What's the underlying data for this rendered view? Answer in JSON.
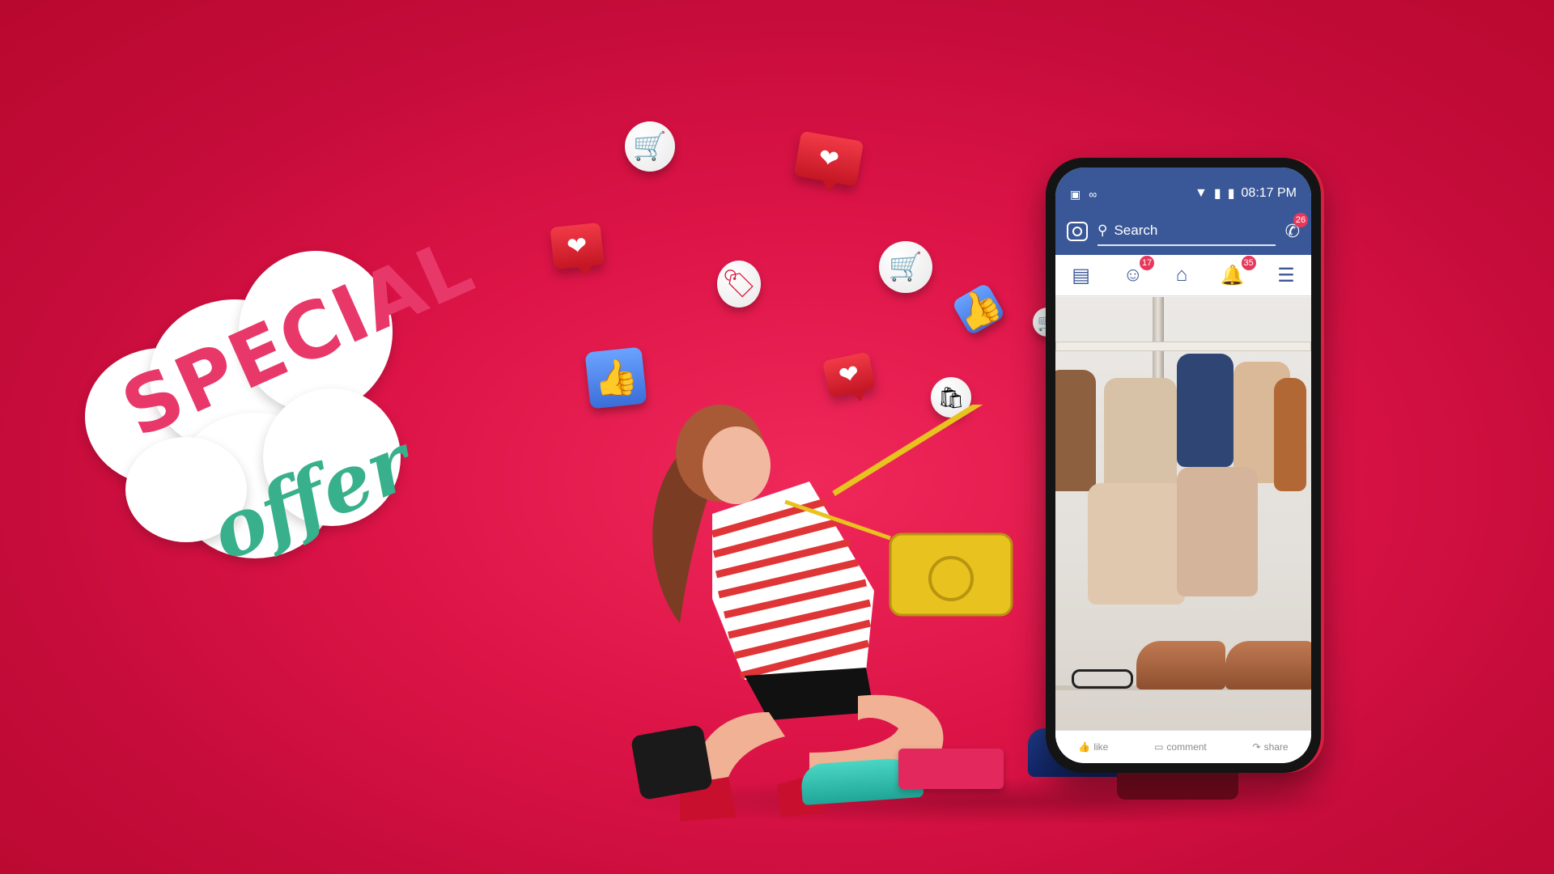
{
  "background_color": "#d81445",
  "sticker": {
    "line1": "SPECIAL",
    "line2": "offer",
    "colors": {
      "line1": "#e8386a",
      "line2": "#38b08b",
      "border": "#ffffff"
    }
  },
  "floating_icons": [
    "cart-icon",
    "heart-icon",
    "heart-icon",
    "price-tag-icon",
    "cart-icon",
    "thumbs-up-icon",
    "thumbs-up-icon",
    "heart-icon",
    "shopping-bag-icon",
    "cart-icon"
  ],
  "phone": {
    "status": {
      "time": "08:17 PM"
    },
    "search": {
      "placeholder": "Search"
    },
    "badges": {
      "messages": "26",
      "friends": "17",
      "notifications": "35"
    },
    "actions": {
      "like": "like",
      "comment": "comment",
      "share": "share"
    },
    "header_color": "#3a5897"
  }
}
